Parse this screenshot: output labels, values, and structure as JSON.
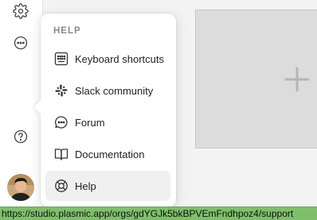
{
  "help_menu": {
    "title": "HELP",
    "items": [
      {
        "label": "Keyboard shortcuts",
        "icon": "keyboard-icon"
      },
      {
        "label": "Slack community",
        "icon": "slack-icon"
      },
      {
        "label": "Forum",
        "icon": "chat-bubble-icon"
      },
      {
        "label": "Documentation",
        "icon": "book-icon"
      },
      {
        "label": "Help",
        "icon": "lifebuoy-icon"
      }
    ],
    "active_item": "Help"
  },
  "rail": {
    "icons": [
      "gear-icon",
      "more-icon",
      "help-icon",
      "avatar"
    ]
  },
  "status_bar": {
    "url": "https://studio.plasmic.app/orgs/gdYGJk5bkBPVEmFndhpoz4/support"
  },
  "colors": {
    "status_bar": "#7fbf6c",
    "popover_bg": "#ffffff",
    "active_item_bg": "#f0f0f0",
    "canvas_placeholder": "#dcdcdc"
  }
}
